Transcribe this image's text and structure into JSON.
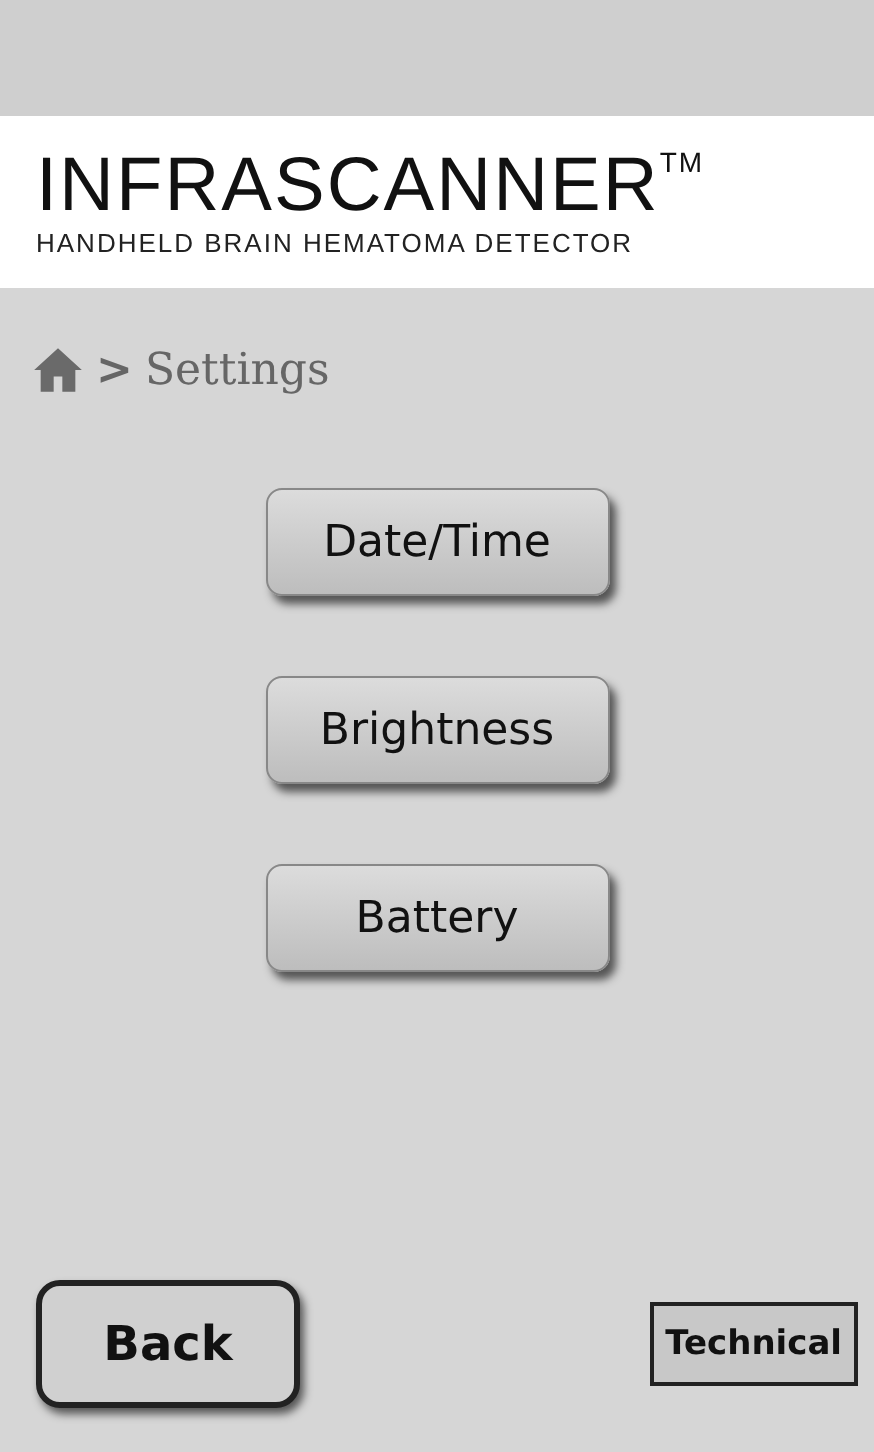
{
  "header": {
    "title": "INFRASCANNER$^{TM}$",
    "subtitle": "HANDHELD BRAIN HEMATOMA DETECTOR"
  },
  "breadcrumb": {
    "separator": ">",
    "current": "Settings"
  },
  "menu_buttons": [
    "Date/Time",
    "Brightness",
    "Battery"
  ],
  "footer": {
    "back": "Back",
    "technical": "Technical"
  }
}
